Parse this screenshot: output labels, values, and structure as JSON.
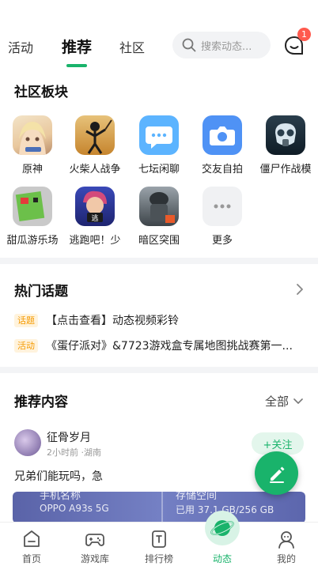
{
  "top_tabs": [
    "活动",
    "推荐",
    "社区"
  ],
  "search": {
    "placeholder": "搜索动态..."
  },
  "notifications": {
    "count": "1"
  },
  "community": {
    "title": "社区板块",
    "items": [
      {
        "label": "原神",
        "icon": "genshin-icon"
      },
      {
        "label": "火柴人战争",
        "icon": "stick-war-icon"
      },
      {
        "label": "七坛闲聊",
        "icon": "chat-bubble-icon"
      },
      {
        "label": "交友自拍",
        "icon": "camera-icon"
      },
      {
        "label": "僵尸作战模",
        "icon": "gas-mask-icon"
      },
      {
        "label": "甜瓜游乐场",
        "icon": "melon-playground-icon"
      },
      {
        "label": "逃跑吧！少",
        "icon": "escape-game-icon"
      },
      {
        "label": "暗区突围",
        "icon": "arena-breakout-icon"
      },
      {
        "label": "更多",
        "icon": "more-icon"
      }
    ]
  },
  "hot_topics": {
    "title": "热门话题",
    "items": [
      {
        "tag": "话题",
        "text": "【点击查看】动态视频彩铃"
      },
      {
        "tag": "活动",
        "text": "《蛋仔派对》&7723游戏盒专属地图挑战赛第一..."
      }
    ]
  },
  "recommended": {
    "title": "推荐内容",
    "filter": "全部",
    "post": {
      "author": "征骨岁月",
      "meta": "2小时前 ·湖南",
      "follow": "+关注",
      "content": "兄弟们能玩吗，急",
      "screenshot": {
        "left_title": "手机名称",
        "left_value": "OPPO A93s 5G",
        "right_title": "存储空间",
        "right_value": "已用 37.1 GB/256 GB"
      }
    }
  },
  "bottom_nav": [
    "首页",
    "游戏库",
    "排行榜",
    "动态",
    "我的"
  ],
  "colors": {
    "accent": "#19b36b",
    "tag": "#f59a00",
    "badge": "#ff5a4e"
  }
}
